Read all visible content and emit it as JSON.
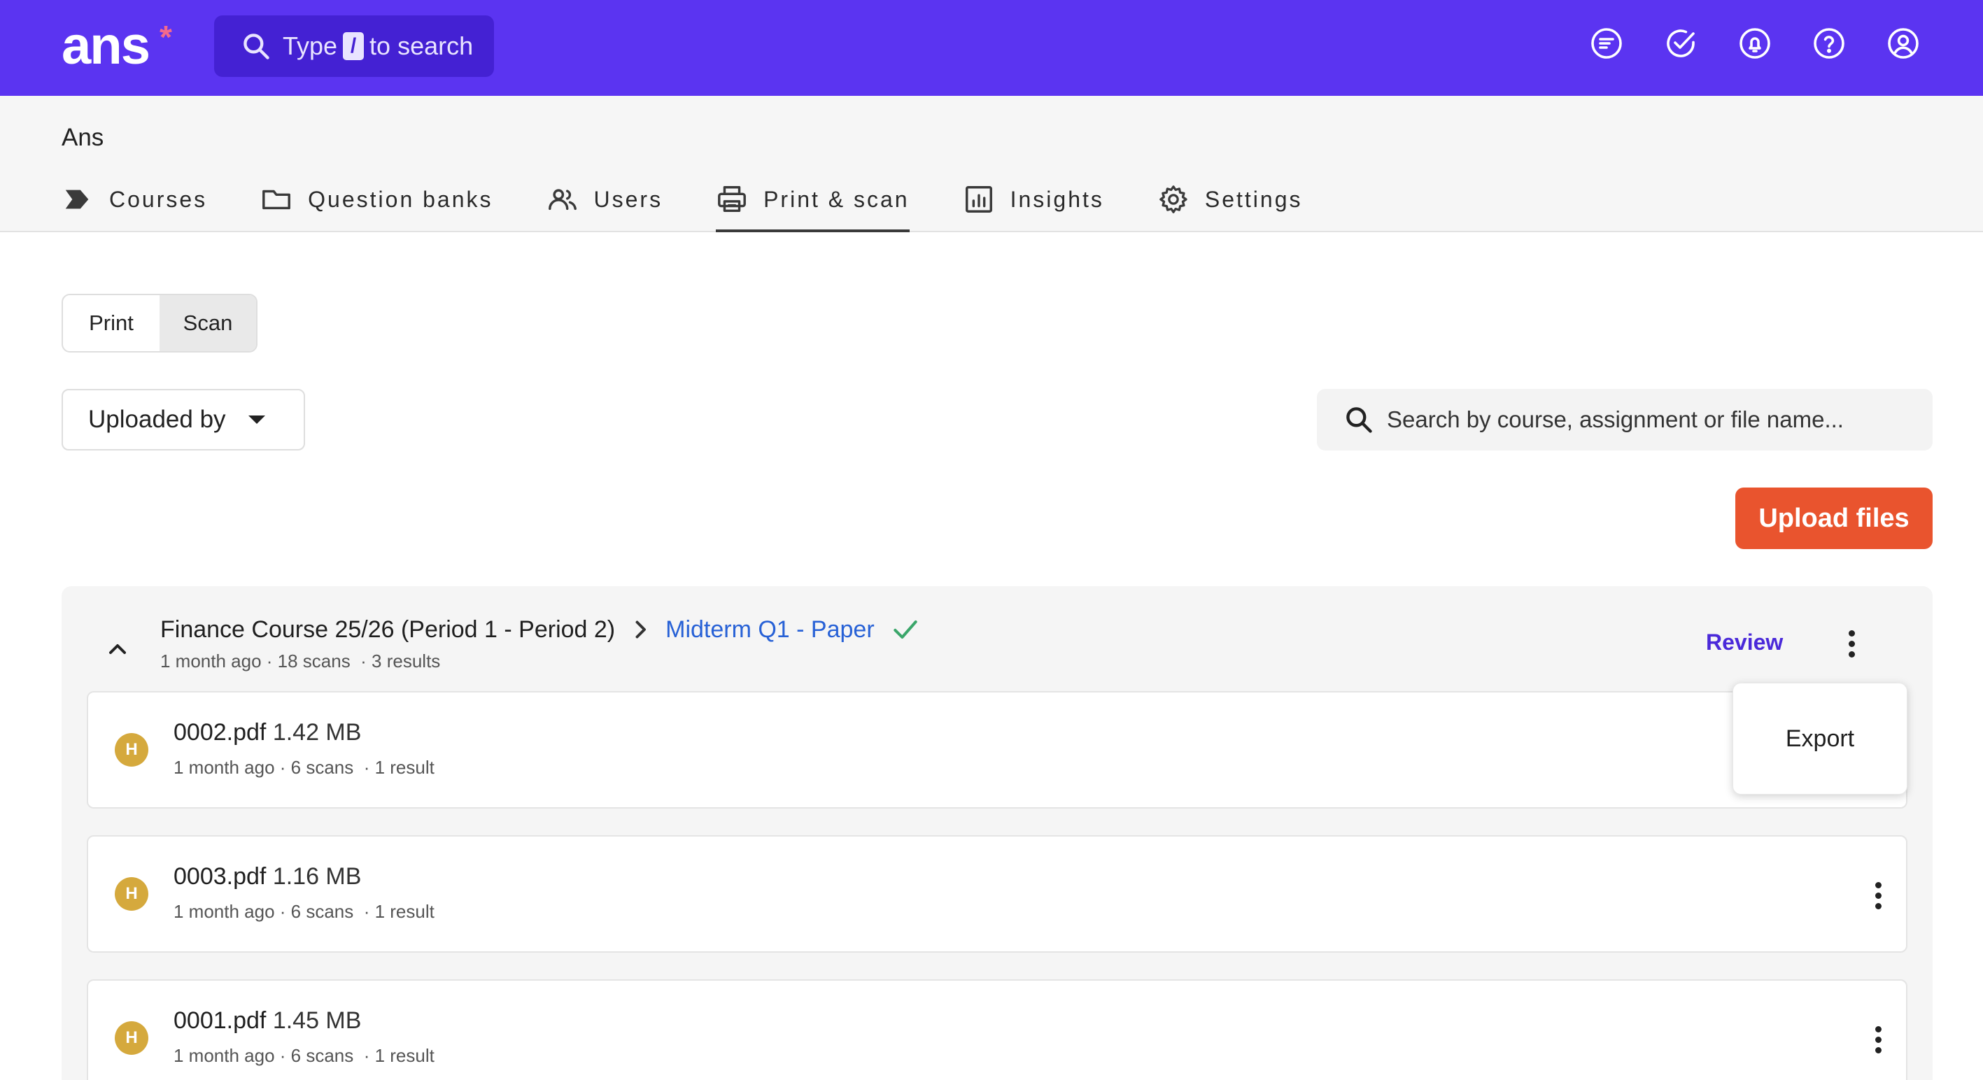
{
  "app": {
    "logo_text": "ans",
    "logo_mark": "*",
    "brand_color": "#5b34f1",
    "accent_color": "#e9542e"
  },
  "global_search": {
    "prefix": "Type",
    "key": "/",
    "suffix": "to search"
  },
  "top_icons": [
    "news-icon",
    "check-circle-icon",
    "bell-icon",
    "help-icon",
    "account-icon"
  ],
  "org_name": "Ans",
  "nav": {
    "tabs": [
      {
        "label": "Courses",
        "icon": "courses-arrow-icon"
      },
      {
        "label": "Question banks",
        "icon": "folder-icon"
      },
      {
        "label": "Users",
        "icon": "users-icon"
      },
      {
        "label": "Print & scan",
        "icon": "printer-icon",
        "active": true
      },
      {
        "label": "Insights",
        "icon": "chart-icon"
      },
      {
        "label": "Settings",
        "icon": "gear-icon"
      }
    ]
  },
  "toggle": {
    "print_label": "Print",
    "scan_label": "Scan",
    "selected": "Scan"
  },
  "filters": {
    "uploaded_by_label": "Uploaded by",
    "search_placeholder": "Search by course, assignment or file name..."
  },
  "upload_button_label": "Upload files",
  "group": {
    "course": "Finance Course 25/26 (Period 1 - Period 2)",
    "assignment": "Midterm Q1 - Paper",
    "meta": "1 month ago · 18 scans  · 3 results",
    "review_label": "Review",
    "files": [
      {
        "avatar": "H",
        "name": "0002.pdf",
        "size": "1.42 MB",
        "meta": "1 month ago · 6 scans  · 1 result"
      },
      {
        "avatar": "H",
        "name": "0003.pdf",
        "size": "1.16 MB",
        "meta": "1 month ago · 6 scans  · 1 result"
      },
      {
        "avatar": "H",
        "name": "0001.pdf",
        "size": "1.45 MB",
        "meta": "1 month ago · 6 scans  · 1 result"
      }
    ]
  },
  "popover": {
    "export_label": "Export"
  }
}
